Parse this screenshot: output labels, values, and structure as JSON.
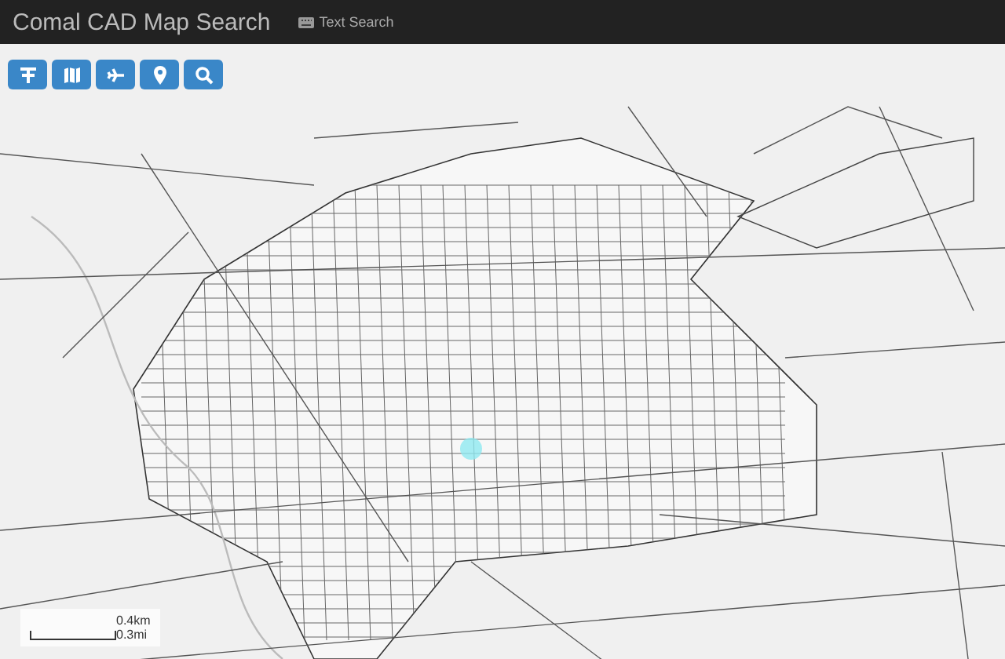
{
  "header": {
    "title": "Comal CAD Map Search",
    "links": [
      {
        "label": "Text Search"
      }
    ]
  },
  "toolbar": {
    "buttons": [
      {
        "kind": "parcels"
      },
      {
        "kind": "map"
      },
      {
        "kind": "plane"
      },
      {
        "kind": "pin"
      },
      {
        "kind": "search"
      }
    ]
  },
  "scale": {
    "metric": "0.4km",
    "imperial": "0.3mi"
  }
}
